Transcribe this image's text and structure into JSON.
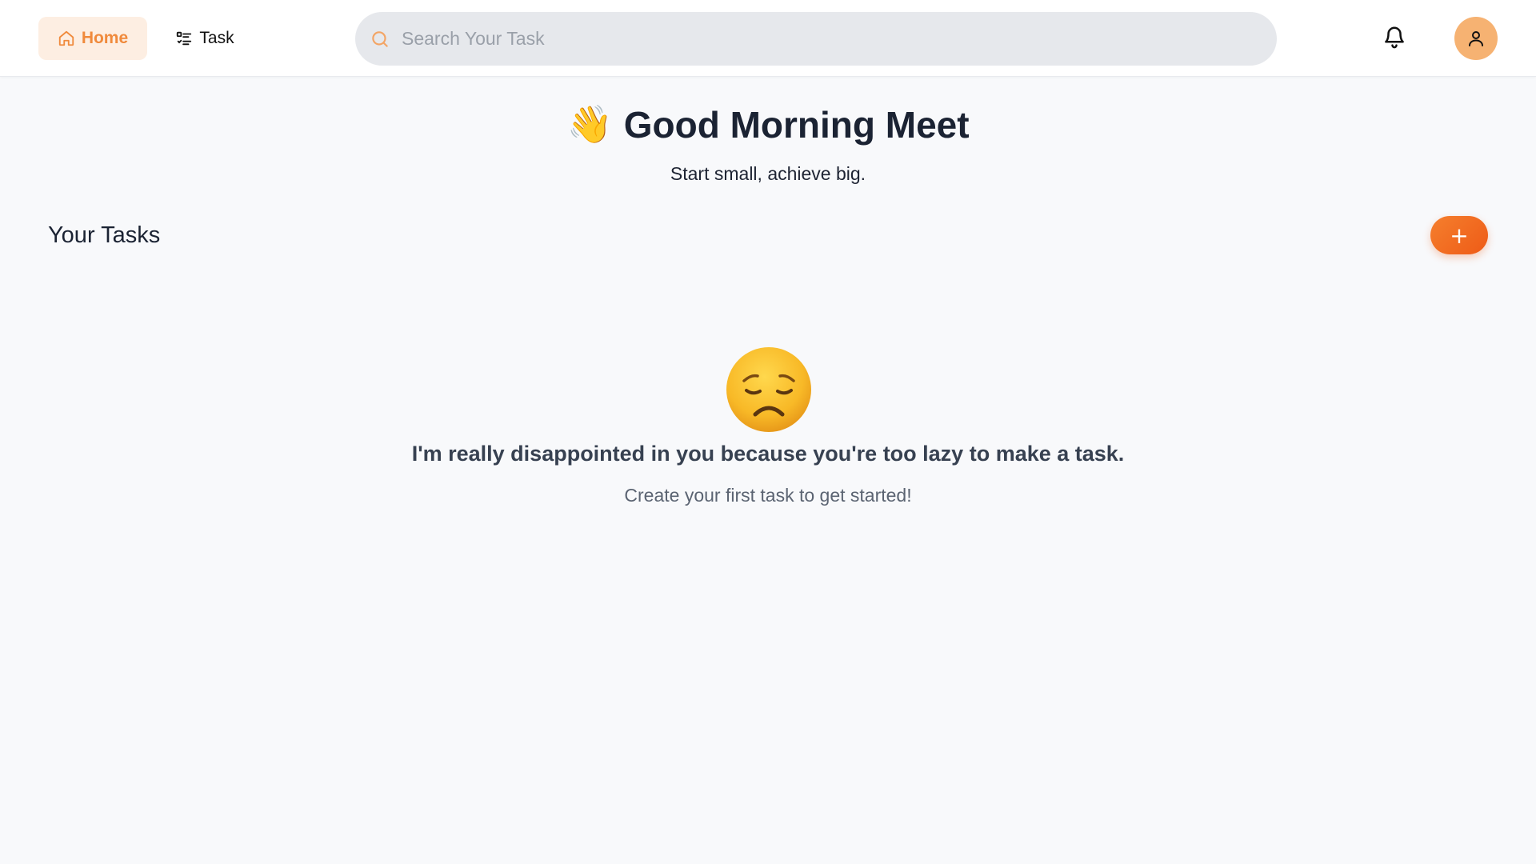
{
  "nav": {
    "home_label": "Home",
    "task_label": "Task"
  },
  "search": {
    "placeholder": "Search Your Task",
    "value": ""
  },
  "greeting": {
    "emoji": "👋",
    "title": "Good Morning Meet",
    "subtitle": "Start small, achieve big."
  },
  "tasks": {
    "section_title": "Your Tasks",
    "add_button_label": "+",
    "empty_emoji": "😞",
    "empty_title": "I'm really disappointed in you because you're too lazy to make a task.",
    "empty_subtitle": "Create your first task to get started!"
  },
  "icons": {
    "home": "home-icon",
    "task": "list-icon",
    "search": "search-icon",
    "notifications": "bell-icon",
    "profile": "user-icon"
  },
  "colors": {
    "accent": "#f08a3c",
    "accent_bg": "#fdeee2",
    "add_button": "#ee5b17",
    "avatar_bg": "#f6b272"
  }
}
